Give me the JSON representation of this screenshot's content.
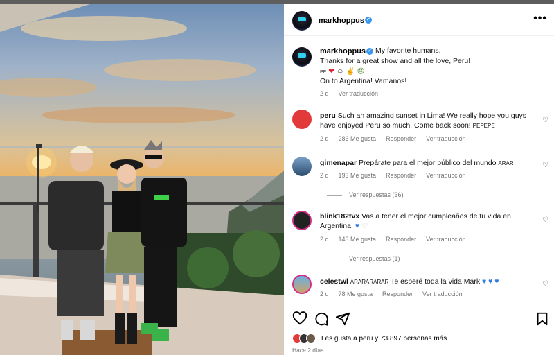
{
  "post": {
    "username": "markhoppus",
    "verified": true,
    "caption_lines": [
      "My favorite humans.",
      "Thanks for a great show and all the love, Peru!",
      "PE ❤️ 🫠 🤘 🤢",
      "On to Argentina! Vamanos!"
    ],
    "caption_first": "My favorite humans.",
    "caption_second": "Thanks for a great show and all the love, Peru!",
    "caption_emoji": "PE",
    "caption_third": "On to Argentina! Vamanos!",
    "age": "2 d",
    "translate": "Ver traducción"
  },
  "comments": [
    {
      "user": "peru",
      "text": "Such an amazing sunset in Lima! We really hope you guys have enjoyed Peru so much. Come back soon!",
      "tag": "PEPEPE",
      "age": "2 d",
      "likes": "286 Me gusta",
      "reply": "Responder",
      "translate": "Ver traducción"
    },
    {
      "user": "gimenapar",
      "text": "Prepárate para el mejor público del mundo",
      "tag": "ARAR",
      "age": "2 d",
      "likes": "193 Me gusta",
      "reply": "Responder",
      "translate": "Ver traducción",
      "replies": "Ver respuestas (36)"
    },
    {
      "user": "blink182tvx",
      "text": "Vas a tener el mejor cumpleaños de tu vida en Argentina!",
      "age": "2 d",
      "likes": "143 Me gusta",
      "reply": "Responder",
      "translate": "Ver traducción",
      "replies": "Ver respuestas (1)"
    },
    {
      "user": "celestwl",
      "tag": "ARARARARAR",
      "text": "Te esperé toda la vida Mark",
      "age": "2 d",
      "likes": "78 Me gusta",
      "reply": "Responder",
      "translate": "Ver traducción"
    }
  ],
  "footer": {
    "likes_text": "Les gusta a peru y 73.897 personas más",
    "ago": "Hace 2 días"
  },
  "icons": {
    "more": "•••",
    "heart_small": "♡"
  },
  "colors": {
    "verified": "#3897f0",
    "meta": "#737373"
  }
}
